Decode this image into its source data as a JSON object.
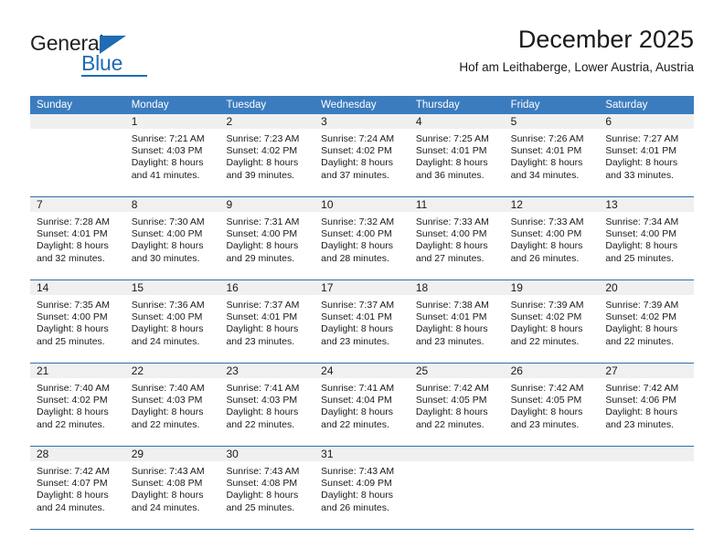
{
  "brand": {
    "name_part1": "General",
    "name_part2": "Blue"
  },
  "header": {
    "title": "December 2025",
    "subtitle": "Hof am Leithaberge, Lower Austria, Austria"
  },
  "calendar": {
    "weekday_headers": [
      "Sunday",
      "Monday",
      "Tuesday",
      "Wednesday",
      "Thursday",
      "Friday",
      "Saturday"
    ],
    "colors": {
      "header_bg": "#3b7cbf",
      "daynum_band": "#f0f0f0",
      "week_divider": "#2f6fab",
      "brand_blue": "#1f6cb4"
    },
    "weeks": [
      [
        {
          "day": "",
          "lines": []
        },
        {
          "day": "1",
          "lines": [
            "Sunrise: 7:21 AM",
            "Sunset: 4:03 PM",
            "Daylight: 8 hours",
            "and 41 minutes."
          ]
        },
        {
          "day": "2",
          "lines": [
            "Sunrise: 7:23 AM",
            "Sunset: 4:02 PM",
            "Daylight: 8 hours",
            "and 39 minutes."
          ]
        },
        {
          "day": "3",
          "lines": [
            "Sunrise: 7:24 AM",
            "Sunset: 4:02 PM",
            "Daylight: 8 hours",
            "and 37 minutes."
          ]
        },
        {
          "day": "4",
          "lines": [
            "Sunrise: 7:25 AM",
            "Sunset: 4:01 PM",
            "Daylight: 8 hours",
            "and 36 minutes."
          ]
        },
        {
          "day": "5",
          "lines": [
            "Sunrise: 7:26 AM",
            "Sunset: 4:01 PM",
            "Daylight: 8 hours",
            "and 34 minutes."
          ]
        },
        {
          "day": "6",
          "lines": [
            "Sunrise: 7:27 AM",
            "Sunset: 4:01 PM",
            "Daylight: 8 hours",
            "and 33 minutes."
          ]
        }
      ],
      [
        {
          "day": "7",
          "lines": [
            "Sunrise: 7:28 AM",
            "Sunset: 4:01 PM",
            "Daylight: 8 hours",
            "and 32 minutes."
          ]
        },
        {
          "day": "8",
          "lines": [
            "Sunrise: 7:30 AM",
            "Sunset: 4:00 PM",
            "Daylight: 8 hours",
            "and 30 minutes."
          ]
        },
        {
          "day": "9",
          "lines": [
            "Sunrise: 7:31 AM",
            "Sunset: 4:00 PM",
            "Daylight: 8 hours",
            "and 29 minutes."
          ]
        },
        {
          "day": "10",
          "lines": [
            "Sunrise: 7:32 AM",
            "Sunset: 4:00 PM",
            "Daylight: 8 hours",
            "and 28 minutes."
          ]
        },
        {
          "day": "11",
          "lines": [
            "Sunrise: 7:33 AM",
            "Sunset: 4:00 PM",
            "Daylight: 8 hours",
            "and 27 minutes."
          ]
        },
        {
          "day": "12",
          "lines": [
            "Sunrise: 7:33 AM",
            "Sunset: 4:00 PM",
            "Daylight: 8 hours",
            "and 26 minutes."
          ]
        },
        {
          "day": "13",
          "lines": [
            "Sunrise: 7:34 AM",
            "Sunset: 4:00 PM",
            "Daylight: 8 hours",
            "and 25 minutes."
          ]
        }
      ],
      [
        {
          "day": "14",
          "lines": [
            "Sunrise: 7:35 AM",
            "Sunset: 4:00 PM",
            "Daylight: 8 hours",
            "and 25 minutes."
          ]
        },
        {
          "day": "15",
          "lines": [
            "Sunrise: 7:36 AM",
            "Sunset: 4:00 PM",
            "Daylight: 8 hours",
            "and 24 minutes."
          ]
        },
        {
          "day": "16",
          "lines": [
            "Sunrise: 7:37 AM",
            "Sunset: 4:01 PM",
            "Daylight: 8 hours",
            "and 23 minutes."
          ]
        },
        {
          "day": "17",
          "lines": [
            "Sunrise: 7:37 AM",
            "Sunset: 4:01 PM",
            "Daylight: 8 hours",
            "and 23 minutes."
          ]
        },
        {
          "day": "18",
          "lines": [
            "Sunrise: 7:38 AM",
            "Sunset: 4:01 PM",
            "Daylight: 8 hours",
            "and 23 minutes."
          ]
        },
        {
          "day": "19",
          "lines": [
            "Sunrise: 7:39 AM",
            "Sunset: 4:02 PM",
            "Daylight: 8 hours",
            "and 22 minutes."
          ]
        },
        {
          "day": "20",
          "lines": [
            "Sunrise: 7:39 AM",
            "Sunset: 4:02 PM",
            "Daylight: 8 hours",
            "and 22 minutes."
          ]
        }
      ],
      [
        {
          "day": "21",
          "lines": [
            "Sunrise: 7:40 AM",
            "Sunset: 4:02 PM",
            "Daylight: 8 hours",
            "and 22 minutes."
          ]
        },
        {
          "day": "22",
          "lines": [
            "Sunrise: 7:40 AM",
            "Sunset: 4:03 PM",
            "Daylight: 8 hours",
            "and 22 minutes."
          ]
        },
        {
          "day": "23",
          "lines": [
            "Sunrise: 7:41 AM",
            "Sunset: 4:03 PM",
            "Daylight: 8 hours",
            "and 22 minutes."
          ]
        },
        {
          "day": "24",
          "lines": [
            "Sunrise: 7:41 AM",
            "Sunset: 4:04 PM",
            "Daylight: 8 hours",
            "and 22 minutes."
          ]
        },
        {
          "day": "25",
          "lines": [
            "Sunrise: 7:42 AM",
            "Sunset: 4:05 PM",
            "Daylight: 8 hours",
            "and 22 minutes."
          ]
        },
        {
          "day": "26",
          "lines": [
            "Sunrise: 7:42 AM",
            "Sunset: 4:05 PM",
            "Daylight: 8 hours",
            "and 23 minutes."
          ]
        },
        {
          "day": "27",
          "lines": [
            "Sunrise: 7:42 AM",
            "Sunset: 4:06 PM",
            "Daylight: 8 hours",
            "and 23 minutes."
          ]
        }
      ],
      [
        {
          "day": "28",
          "lines": [
            "Sunrise: 7:42 AM",
            "Sunset: 4:07 PM",
            "Daylight: 8 hours",
            "and 24 minutes."
          ]
        },
        {
          "day": "29",
          "lines": [
            "Sunrise: 7:43 AM",
            "Sunset: 4:08 PM",
            "Daylight: 8 hours",
            "and 24 minutes."
          ]
        },
        {
          "day": "30",
          "lines": [
            "Sunrise: 7:43 AM",
            "Sunset: 4:08 PM",
            "Daylight: 8 hours",
            "and 25 minutes."
          ]
        },
        {
          "day": "31",
          "lines": [
            "Sunrise: 7:43 AM",
            "Sunset: 4:09 PM",
            "Daylight: 8 hours",
            "and 26 minutes."
          ]
        },
        {
          "day": "",
          "lines": []
        },
        {
          "day": "",
          "lines": []
        },
        {
          "day": "",
          "lines": []
        }
      ]
    ]
  }
}
